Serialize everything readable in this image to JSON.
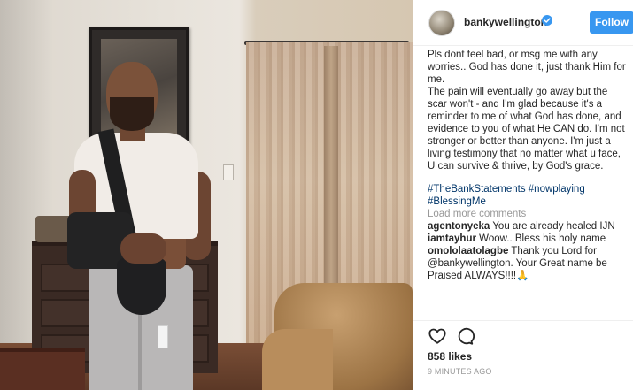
{
  "post": {
    "username": "bankywellington",
    "follow_label": "Follow"
  },
  "caption": {
    "cut_top_line": "Pls dont feel bad, or msg me with any worries.. God has done it, just thank Him for me.",
    "line1": "Pls dont feel bad, or msg me with any worries.. God has done it, just thank Him for me.",
    "paragraph2": "The pain will eventually go away but the scar won't - and I'm glad because it's a reminder to me of what God has done, and evidence to you of what He CAN do. I'm not stronger or better than anyone. I'm just a living testimony that no matter what u face, U can survive & thrive, by God's grace.",
    "hashtags": "#TheBankStatements #nowplaying #BlessingMe"
  },
  "comments": {
    "load_more": "Load more comments",
    "items": [
      {
        "user": "agentonyeka",
        "text": "You are already healed IJN"
      },
      {
        "user": "iamtayhur",
        "text": "Woow.. Bless his holy name"
      },
      {
        "user": "omololaatolagbe",
        "text": "Thank you Lord for @bankywellington. Your Great name be Praised ALWAYS!!!!🙏"
      }
    ]
  },
  "footer": {
    "likes": "858 likes",
    "time": "9 MINUTES AGO"
  },
  "colors": {
    "accent": "#3897f0",
    "hashtag": "#003569",
    "muted": "#999999"
  },
  "icons": {
    "verified": "verified-badge-icon",
    "like": "heart-outline-icon",
    "comment": "speech-bubble-icon"
  }
}
